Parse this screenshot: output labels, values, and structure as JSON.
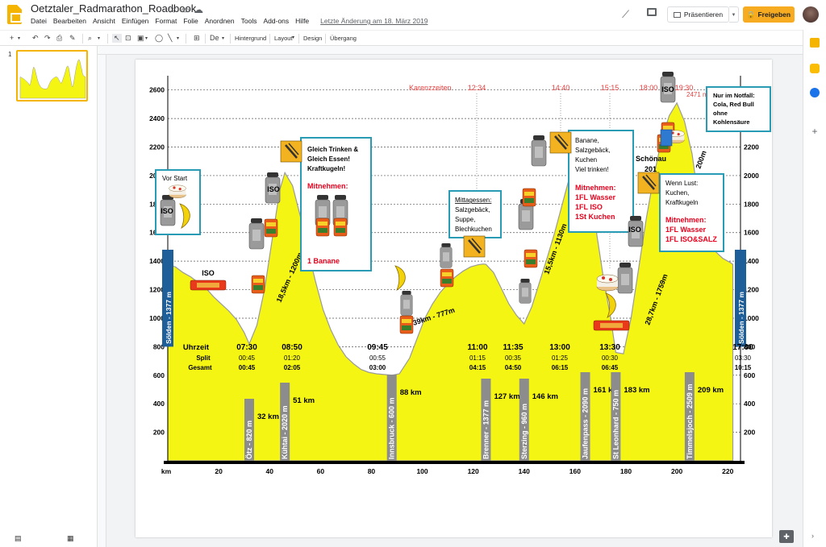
{
  "doc": {
    "title": "Oetztaler_Radmarathon_Roadbook"
  },
  "menu": {
    "items": [
      "Datei",
      "Bearbeiten",
      "Ansicht",
      "Einfügen",
      "Format",
      "Folie",
      "Anordnen",
      "Tools",
      "Add-ons",
      "Hilfe"
    ],
    "last_edit": "Letzte Änderung am 18. März 2019"
  },
  "header": {
    "present_label": "Präsentieren",
    "share_label": "Freigeben"
  },
  "toolbar": {
    "background_label": "Hintergrund",
    "layout_label": "Layout",
    "design_label": "Design",
    "transition_label": "Übergang"
  },
  "filmstrip": {
    "slide_number": "1"
  },
  "slide": {
    "aid_station_heading": "Karenzzeiten",
    "cutoff_times": [
      "12:34",
      "14:40",
      "15:15",
      "18:00",
      "19:30"
    ],
    "peak_label": "2471 m",
    "start_finish_label": "Sölden - 1377 m",
    "climb_labels": [
      "18,5km - 1200m",
      "39km - 777m",
      "15,5km - 1130m",
      "28,7km - 1759m",
      "200m"
    ],
    "iso_label": "ISO",
    "schoenau_label": "Schönau",
    "schoenau_sub": "201",
    "notes": {
      "vor_start": "Vor Start",
      "kuehtai": {
        "lines": [
          "Gleich Trinken &",
          "Gleich Essen!",
          "Kraftkugeln!"
        ],
        "mitnehmen": "Mitnehmen:",
        "extra": "1 Banane"
      },
      "brenner": {
        "heading": "Mittagessen:",
        "lines": [
          "Salzgebäck,",
          "Suppe,",
          "Blechkuchen"
        ]
      },
      "jaufen": {
        "lines": [
          "Banane,",
          "Salzgebäck,",
          "Kuchen",
          "Viel trinken!"
        ],
        "mitnehmen": "Mitnehmen:",
        "items": [
          "1FL Wasser",
          "1FL ISO",
          "1St Kuchen"
        ]
      },
      "timmels": {
        "lines": [
          "Wenn Lust:",
          "Kuchen,",
          "Kraftkugeln"
        ],
        "mitnehmen": "Mitnehmen:",
        "items": [
          "1FL Wasser",
          "1FL ISO&SALZ"
        ]
      },
      "notfall": {
        "lines": [
          "Nur im Notfall:",
          "Cola, Red Bull",
          "ohne",
          "Kohlensäure"
        ]
      }
    },
    "timing": {
      "row_labels": [
        "Uhrzeit",
        "Split",
        "Gesamt"
      ],
      "columns": [
        {
          "time": "07:30",
          "split": "00:45",
          "total": "00:45"
        },
        {
          "time": "08:50",
          "split": "01:20",
          "total": "02:05"
        },
        {
          "time": "09:45",
          "split": "00:55",
          "total": "03:00"
        },
        {
          "time": "11:00",
          "split": "01:15",
          "total": "04:15"
        },
        {
          "time": "11:35",
          "split": "00:35",
          "total": "04:50"
        },
        {
          "time": "13:00",
          "split": "01:25",
          "total": "06:15"
        },
        {
          "time": "13:30",
          "split": "00:30",
          "total": "06:45"
        },
        {
          "time": "17:00",
          "split": "03:30",
          "total": "10:15"
        }
      ]
    },
    "places": [
      {
        "name": "Ötz - 820 m",
        "km": 32,
        "km_label": "32 km"
      },
      {
        "name": "Kühtai - 2020 m",
        "km": 46,
        "km_label": "51 km"
      },
      {
        "name": "Innsbruck - 600 m",
        "km": 88,
        "km_label": "88 km"
      },
      {
        "name": "Brenner - 1377 m",
        "km": 125,
        "km_label": "127 km"
      },
      {
        "name": "Sterzing - 960 m",
        "km": 140,
        "km_label": "146 km"
      },
      {
        "name": "Jaufenpass - 2090 m",
        "km": 164,
        "km_label": "161 km"
      },
      {
        "name": "St Leonhard - 750 m",
        "km": 176,
        "km_label": "183 km"
      },
      {
        "name": "Timmelsjoch - 2509 m",
        "km": 205,
        "km_label": "209 km"
      }
    ]
  },
  "chart_data": {
    "type": "area",
    "title": "",
    "xlabel": "km",
    "ylabel": "",
    "xlim": [
      0,
      225
    ],
    "ylim": [
      0,
      2700
    ],
    "xticks": [
      20,
      40,
      60,
      80,
      100,
      120,
      140,
      160,
      180,
      200,
      220
    ],
    "yticks": [
      200,
      400,
      600,
      800,
      1000,
      1200,
      1400,
      1600,
      1800,
      2000,
      2200,
      2400,
      2600
    ],
    "grid": true,
    "series": [
      {
        "x": [
          0,
          3,
          6,
          9,
          12,
          15,
          18,
          21,
          24,
          27,
          30,
          32,
          35,
          38,
          41,
          44,
          46,
          49,
          52,
          55,
          58,
          61,
          64,
          67,
          70,
          73,
          76,
          79,
          82,
          85,
          88,
          91,
          95,
          98,
          101,
          104,
          107,
          110,
          113,
          116,
          119,
          122,
          124,
          125,
          128,
          131,
          134,
          137,
          140,
          143,
          146,
          149,
          152,
          155,
          158,
          161,
          162,
          165,
          168,
          171,
          174,
          176,
          179,
          182,
          185,
          188,
          191,
          194,
          197,
          200,
          203,
          206,
          207,
          209,
          212,
          215,
          218,
          221,
          222
        ],
        "y": [
          1377,
          1360,
          1320,
          1290,
          1250,
          1210,
          1150,
          1100,
          1050,
          990,
          900,
          820,
          950,
          1200,
          1550,
          1900,
          2020,
          1930,
          1720,
          1480,
          1260,
          1060,
          920,
          810,
          730,
          680,
          640,
          620,
          610,
          605,
          600,
          610,
          720,
          860,
          1000,
          1100,
          1180,
          1240,
          1290,
          1330,
          1360,
          1375,
          1380,
          1377,
          1320,
          1210,
          1100,
          1020,
          960,
          1080,
          1250,
          1420,
          1600,
          1800,
          2000,
          2080,
          2090,
          1950,
          1650,
          1300,
          1000,
          760,
          750,
          1000,
          1350,
          1700,
          2000,
          2250,
          2420,
          2509,
          2380,
          2150,
          2020,
          1900,
          1600,
          1470,
          1420,
          1390,
          1377
        ]
      }
    ]
  },
  "colors": {
    "accent": "#f4b400",
    "share": "#f7ab20",
    "profile_fill": "#f5f514",
    "note_border": "#2a9bb5",
    "note_red": "#e8001c",
    "cutoff_red": "#e84040",
    "place_bar": "#8c8c8c"
  }
}
